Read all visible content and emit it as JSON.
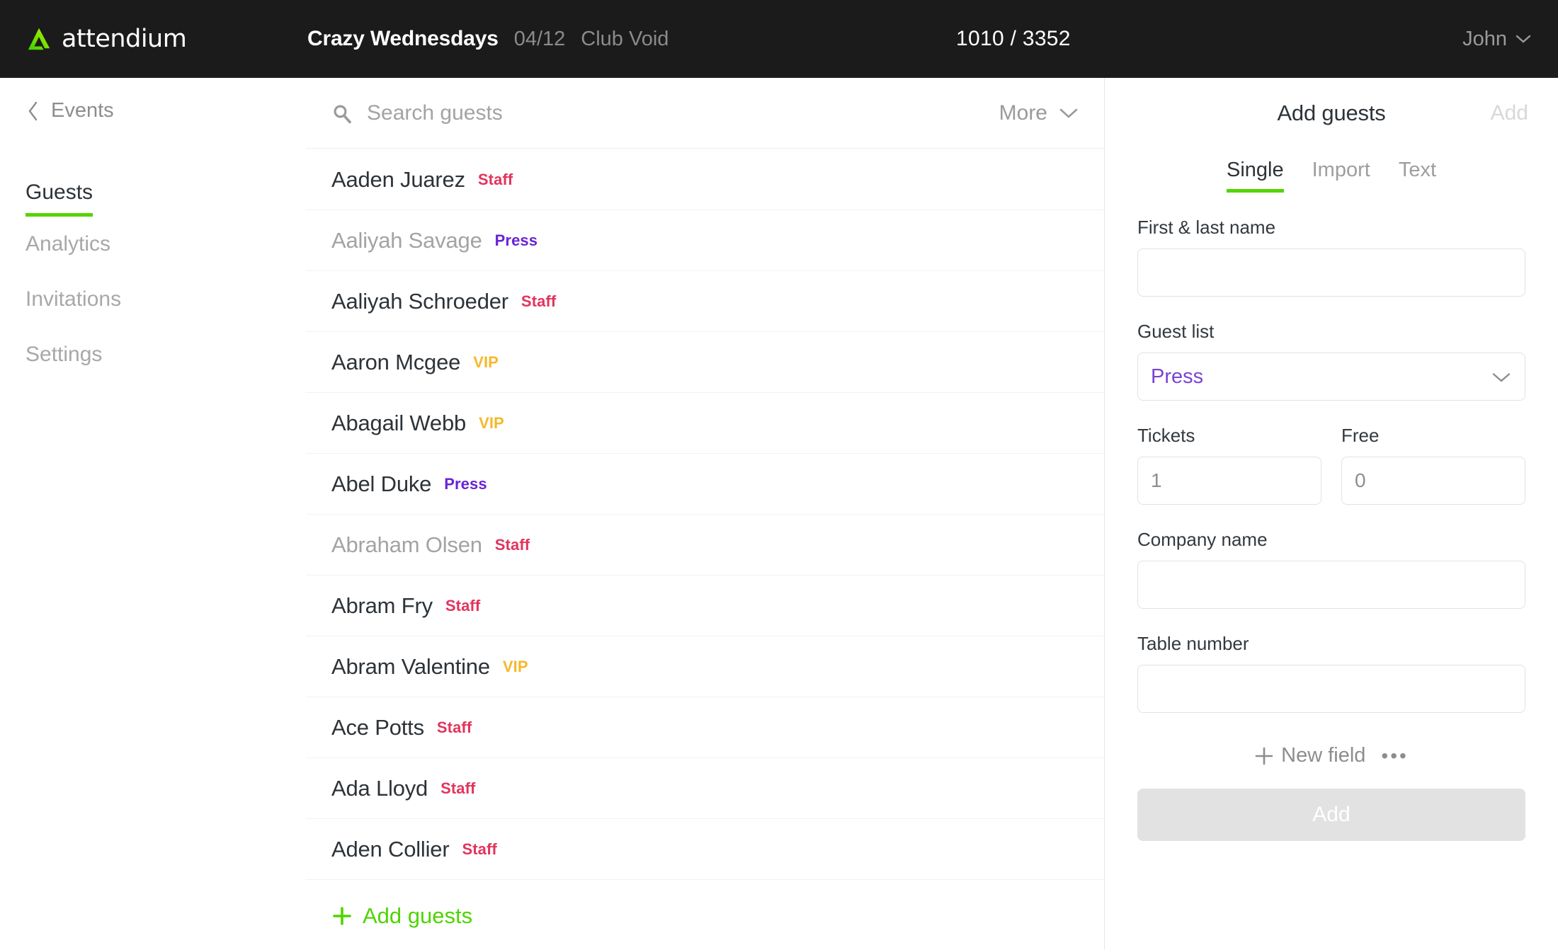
{
  "brand": {
    "name": "attendium",
    "logo_icon": "triangle-logo-icon",
    "accent": "#7ed321"
  },
  "header": {
    "event_name": "Crazy Wednesdays",
    "event_date": "04/12",
    "event_venue": "Club Void",
    "counter": "1010 / 3352",
    "user_name": "John",
    "user_chevron_icon": "chevron-down-icon"
  },
  "sidebar": {
    "back_label": "Events",
    "back_icon": "chevron-left-icon",
    "items": [
      {
        "label": "Guests",
        "active": true
      },
      {
        "label": "Analytics",
        "active": false
      },
      {
        "label": "Invitations",
        "active": false
      },
      {
        "label": "Settings",
        "active": false
      }
    ]
  },
  "toolbar": {
    "search_placeholder": "Search guests",
    "search_value": "",
    "search_icon": "search-icon",
    "more_label": "More",
    "more_icon": "chevron-down-icon"
  },
  "guest_list": {
    "footer_label": "Add guests",
    "footer_icon": "plus-icon",
    "rows": [
      {
        "name": "Aaden Juarez",
        "badge": "Staff",
        "badge_type": "staff",
        "dim": false
      },
      {
        "name": "Aaliyah Savage",
        "badge": "Press",
        "badge_type": "press",
        "dim": true
      },
      {
        "name": "Aaliyah Schroeder",
        "badge": "Staff",
        "badge_type": "staff",
        "dim": false
      },
      {
        "name": "Aaron Mcgee",
        "badge": "VIP",
        "badge_type": "vip",
        "dim": false
      },
      {
        "name": "Abagail Webb",
        "badge": "VIP",
        "badge_type": "vip",
        "dim": false
      },
      {
        "name": "Abel Duke",
        "badge": "Press",
        "badge_type": "press",
        "dim": false
      },
      {
        "name": "Abraham Olsen",
        "badge": "Staff",
        "badge_type": "staff",
        "dim": true
      },
      {
        "name": "Abram Fry",
        "badge": "Staff",
        "badge_type": "staff",
        "dim": false
      },
      {
        "name": "Abram Valentine",
        "badge": "VIP",
        "badge_type": "vip",
        "dim": false
      },
      {
        "name": "Ace Potts",
        "badge": "Staff",
        "badge_type": "staff",
        "dim": false
      },
      {
        "name": "Ada Lloyd",
        "badge": "Staff",
        "badge_type": "staff",
        "dim": false
      },
      {
        "name": "Aden Collier",
        "badge": "Staff",
        "badge_type": "staff",
        "dim": false
      }
    ]
  },
  "panel": {
    "title": "Add guests",
    "add_top_label": "Add",
    "tabs": [
      {
        "label": "Single",
        "active": true
      },
      {
        "label": "Import",
        "active": false
      },
      {
        "label": "Text",
        "active": false
      }
    ],
    "fields": {
      "name": {
        "label": "First & last name",
        "value": "",
        "placeholder": ""
      },
      "guest_list": {
        "label": "Guest list",
        "value": "Press",
        "chevron_icon": "chevron-down-icon",
        "value_color": "#7a43d4"
      },
      "tickets": {
        "label": "Tickets",
        "value": "",
        "placeholder": "1"
      },
      "free": {
        "label": "Free",
        "value": "",
        "placeholder": "0"
      },
      "company": {
        "label": "Company name",
        "value": "",
        "placeholder": ""
      },
      "table_number": {
        "label": "Table number",
        "value": "",
        "placeholder": ""
      }
    },
    "new_field_label": "New field",
    "new_field_icon": "plus-icon",
    "overflow_icon": "ellipsis-icon",
    "overflow_label": "•••",
    "submit_label": "Add",
    "submit_disabled": true
  },
  "colors": {
    "topbar_bg": "#1b1b1b",
    "accent_green": "#55d400",
    "badge_staff": "#e2345c",
    "badge_press": "#6823d6",
    "badge_vip": "#f6b82c"
  }
}
